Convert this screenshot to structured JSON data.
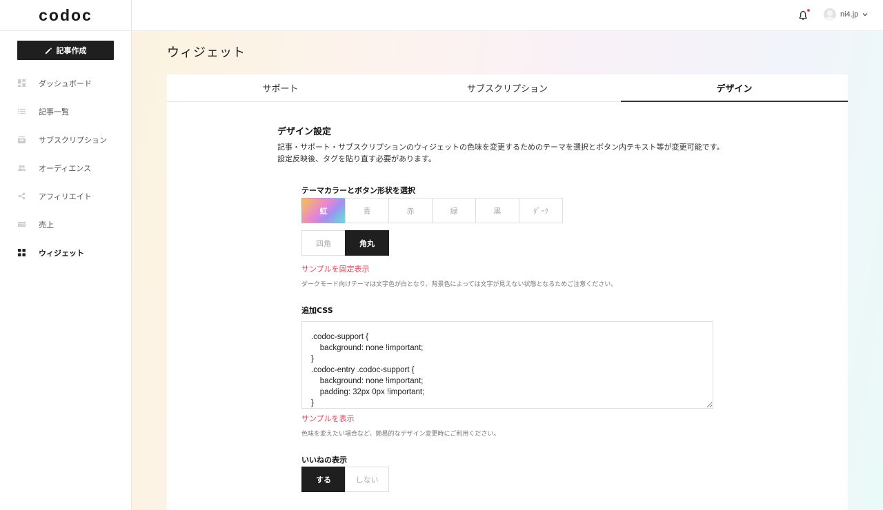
{
  "app": {
    "logo": "codoc"
  },
  "sidebar": {
    "write_button": "記事作成",
    "items": [
      {
        "label": "ダッシュボード",
        "icon": "dashboard-icon"
      },
      {
        "label": "記事一覧",
        "icon": "list-icon"
      },
      {
        "label": "サブスクリプション",
        "icon": "subscription-icon"
      },
      {
        "label": "オーディエンス",
        "icon": "audience-icon"
      },
      {
        "label": "アフィリエイト",
        "icon": "share-icon"
      },
      {
        "label": "売上",
        "icon": "sales-icon"
      },
      {
        "label": "ウィジェット",
        "icon": "widget-icon",
        "active": true
      }
    ]
  },
  "header": {
    "user_name": "ni4.jp",
    "notification_badge": true
  },
  "page": {
    "title": "ウィジェット"
  },
  "tabs": [
    {
      "label": "サポート"
    },
    {
      "label": "サブスクリプション"
    },
    {
      "label": "デザイン",
      "active": true
    }
  ],
  "design": {
    "title": "デザイン設定",
    "description_line1": "記事・サポート・サブスクリプションのウィジェットの色味を変更するためのテーマを選択とボタン内テキスト等が変更可能です。",
    "description_line2": "設定反映後、タグを貼り直す必要があります。",
    "theme_label": "テーマカラーとボタン形状を選択",
    "colors": [
      "虹",
      "青",
      "赤",
      "緑",
      "黒",
      "ﾀﾞｰｸ"
    ],
    "selected_color": "虹",
    "shapes": [
      "四角",
      "角丸"
    ],
    "selected_shape": "角丸",
    "sample_fixed_link": "サンプルを固定表示",
    "dark_note": "ダークモード向けテーマは文字色が白となり、背景色によっては文字が見えない状態となるためご注意ください。",
    "css_label": "追加CSS",
    "css_value": ".codoc-support {\n    background: none !important;\n}\n.codoc-entry .codoc-support {\n    background: none !important;\n    padding: 32px 0px !important;\n}",
    "sample_link": "サンプルを表示",
    "css_note": "色味を変えたい場合など、簡易的なデザイン変更時にご利用ください。",
    "like_label": "いいねの表示",
    "like_options": [
      "する",
      "しない"
    ],
    "like_selected": "する"
  },
  "colors": {
    "accent_red": "#d9455a",
    "dark": "#1f1f1f"
  }
}
